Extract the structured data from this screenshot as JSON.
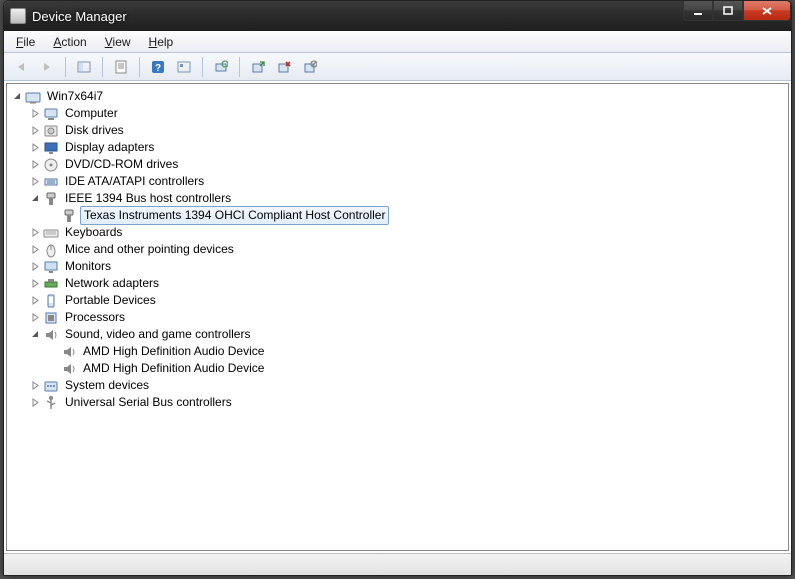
{
  "title": "Device Manager",
  "menubar": {
    "file": "File",
    "action": "Action",
    "view": "View",
    "help": "Help"
  },
  "tree": {
    "root": {
      "label": "Win7x64i7",
      "expanded": true
    },
    "categories": [
      {
        "id": "computer",
        "label": "Computer",
        "expanded": false,
        "icon": "computer"
      },
      {
        "id": "disk",
        "label": "Disk drives",
        "expanded": false,
        "icon": "disk"
      },
      {
        "id": "display",
        "label": "Display adapters",
        "expanded": false,
        "icon": "display"
      },
      {
        "id": "dvd",
        "label": "DVD/CD-ROM drives",
        "expanded": false,
        "icon": "dvd"
      },
      {
        "id": "ide",
        "label": "IDE ATA/ATAPI controllers",
        "expanded": false,
        "icon": "ide"
      },
      {
        "id": "ieee1394",
        "label": "IEEE 1394 Bus host controllers",
        "expanded": true,
        "icon": "ieee1394",
        "children": [
          {
            "id": "ti1394",
            "label": "Texas Instruments 1394 OHCI Compliant Host Controller",
            "icon": "ieee1394",
            "selected": true
          }
        ]
      },
      {
        "id": "keyboards",
        "label": "Keyboards",
        "expanded": false,
        "icon": "keyboard"
      },
      {
        "id": "mice",
        "label": "Mice and other pointing devices",
        "expanded": false,
        "icon": "mouse"
      },
      {
        "id": "monitors",
        "label": "Monitors",
        "expanded": false,
        "icon": "monitor"
      },
      {
        "id": "network",
        "label": "Network adapters",
        "expanded": false,
        "icon": "network"
      },
      {
        "id": "portable",
        "label": "Portable Devices",
        "expanded": false,
        "icon": "portable"
      },
      {
        "id": "processors",
        "label": "Processors",
        "expanded": false,
        "icon": "processor"
      },
      {
        "id": "sound",
        "label": "Sound, video and game controllers",
        "expanded": true,
        "icon": "sound",
        "children": [
          {
            "id": "amd1",
            "label": "AMD High Definition Audio Device",
            "icon": "sound"
          },
          {
            "id": "amd2",
            "label": "AMD High Definition Audio Device",
            "icon": "sound"
          }
        ]
      },
      {
        "id": "system",
        "label": "System devices",
        "expanded": false,
        "icon": "system"
      },
      {
        "id": "usb",
        "label": "Universal Serial Bus controllers",
        "expanded": false,
        "icon": "usb"
      }
    ]
  }
}
